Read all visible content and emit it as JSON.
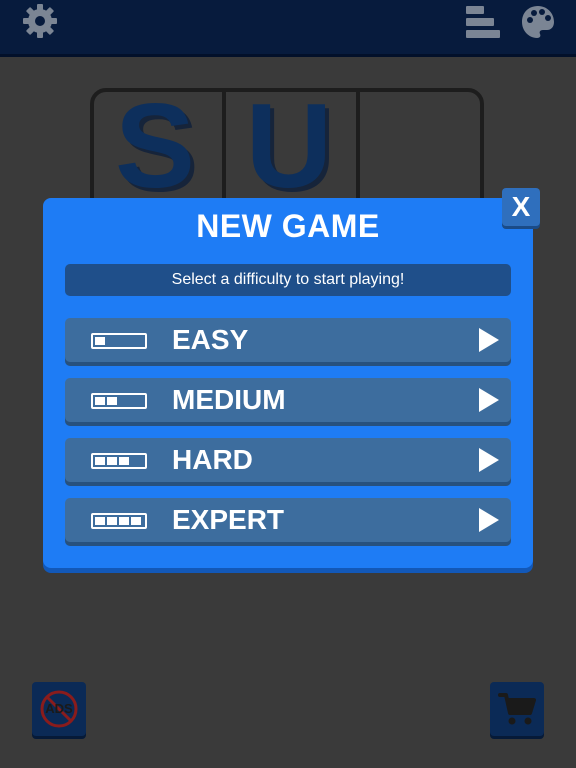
{
  "logo": {
    "letters": [
      "S",
      "U"
    ]
  },
  "modal": {
    "title": "NEW GAME",
    "subtitle": "Select a difficulty to start playing!",
    "close_label": "X",
    "difficulties": [
      {
        "label": "EASY",
        "level": 1,
        "max_level": 4
      },
      {
        "label": "MEDIUM",
        "level": 2,
        "max_level": 4
      },
      {
        "label": "HARD",
        "level": 3,
        "max_level": 4
      },
      {
        "label": "EXPERT",
        "level": 4,
        "max_level": 4
      }
    ]
  },
  "bottom": {
    "ads_label": "ADS"
  },
  "icons": {
    "settings": "gear-icon",
    "stats": "bars-icon",
    "themes": "palette-icon",
    "no_ads": "no-ads-icon",
    "shop": "cart-icon",
    "difficulty": "play-arrow-icon"
  },
  "colors": {
    "background": "#3a3a3a",
    "topbar": "#071b3d",
    "modal": "#1e7cf5",
    "row": "#3d6d9e",
    "subtitle_bg": "#1f4f8a",
    "logo_letters": "#0d2f5c"
  }
}
